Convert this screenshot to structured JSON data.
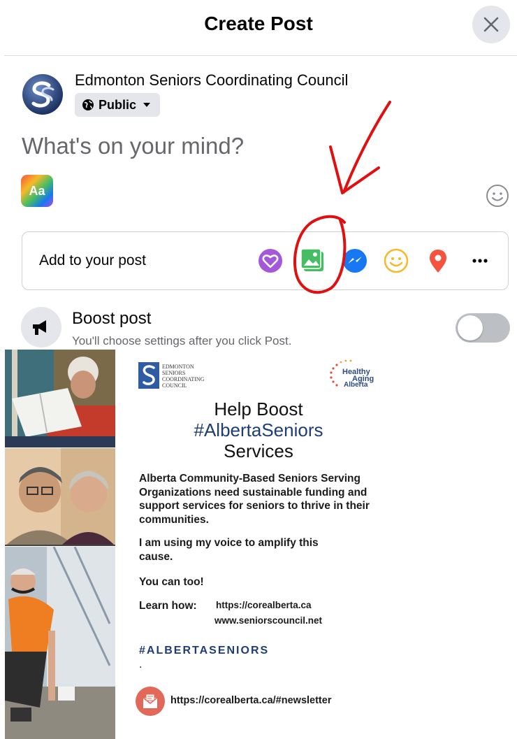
{
  "dialog": {
    "title": "Create Post"
  },
  "author": {
    "name": "Edmonton Seniors Coordinating Council",
    "audience": "Public"
  },
  "composer": {
    "placeholder": "What's on your mind?",
    "text_style_label": "Aa"
  },
  "add_to_post": {
    "label": "Add to your post",
    "icons": [
      "feeling-heart-icon",
      "photo-video-icon",
      "messenger-icon",
      "emoji-activity-icon",
      "location-pin-icon",
      "more-icon"
    ]
  },
  "boost": {
    "title": "Boost post",
    "subtitle": "You'll choose settings after you click Post.",
    "enabled": false
  },
  "flyer": {
    "logo_left": [
      "EDMONTON",
      "SENIORS",
      "COORDINATING",
      "COUNCIL"
    ],
    "logo_right": [
      "Healthy",
      "Aging",
      "Alberta"
    ],
    "headline_1": "Help Boost",
    "headline_2": "#AlbertaSeniors",
    "headline_3": "Services",
    "paragraph_1": "Alberta Community-Based Seniors Serving Organizations need sustainable funding and support services for seniors to thrive in their communities.",
    "paragraph_2": "I am using my voice to amplify this cause.",
    "paragraph_3": "You can too!",
    "learn_label": "Learn how:",
    "link_1": "https://corealberta.ca",
    "link_2": "www.seniorscouncil.net",
    "hashtag": "#ALBERTASENIORS",
    "dot": ".",
    "newsletter_link": "https://corealberta.ca/#newsletter"
  },
  "colors": {
    "primary_text": "#050505",
    "secondary_text": "#65676b",
    "button_gray": "#e4e6eb",
    "annotation_red": "#e01010",
    "flyer_blue": "#1f3d75"
  }
}
